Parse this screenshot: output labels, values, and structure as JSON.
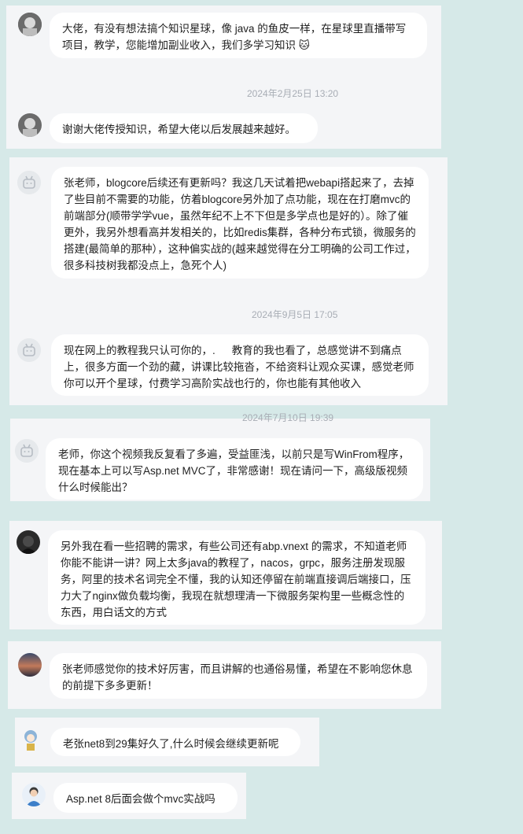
{
  "messages": [
    {
      "text": "大佬，有没有想法搞个知识星球，像 java 的鱼皮一样，在星球里直播带写项目，教学，您能增加副业收入，我们多学习知识 🐱"
    },
    {
      "time": "2024年2月25日 13:20",
      "text": "谢谢大佬传授知识，希望大佬以后发展越来越好。"
    },
    {
      "text": "张老师，blogcore后续还有更新吗？我这几天试着把webapi搭起来了，去掉了些目前不需要的功能，仿着blogcore另外加了点功能，现在在打磨mvc的前端部分(顺带学学vue，虽然年纪不上不下但是多学点也是好的）。除了催更外，我另外想看高并发相关的，比如redis集群，各种分布式锁，微服务的搭建(最简单的那种），这种偏实战的(越来越觉得在分工明确的公司工作过，很多科技树我都没点上，急死个人)"
    },
    {
      "time": "2024年9月5日 17:05",
      "text": "现在网上的教程我只认可你的，. 　 教育的我也看了，总感觉讲不到痛点上，很多方面一个劲的藏，讲课比较拖沓，不给资料让观众买课，感觉老师你可以开个星球，付费学习高阶实战也行的，你也能有其他收入"
    },
    {
      "time": "2024年7月10日 19:39",
      "text": "老师，你这个视频我反复看了多遍，受益匪浅，以前只是写WinFrom程序，现在基本上可以写Asp.net MVC了，非常感谢！现在请问一下，高级版视频什么时候能出？"
    },
    {
      "text": "另外我在看一些招聘的需求，有些公司还有abp.vnext 的需求，不知道老师你能不能讲一讲？网上太多java的教程了，nacos，grpc，服务注册发现服务，阿里的技术名词完全不懂，我的认知还停留在前端直接调后端接口，压力大了nginx做负载均衡，我现在就想理清一下微服务架构里一些概念性的东西，用白话文的方式"
    },
    {
      "text": "张老师感觉你的技术好厉害，而且讲解的也通俗易懂，希望在不影响您休息的前提下多多更新！"
    },
    {
      "text": "老张net8到29集好久了,什么时候会继续更新呢"
    },
    {
      "text": "Asp.net 8后面会做个mvc实战吗"
    }
  ],
  "icons": {
    "avatar_1": "user-avatar-icon",
    "avatar_tv": "bilibili-tv-avatar-icon",
    "avatar_dark": "dark-avatar-icon",
    "avatar_sunset": "sunset-avatar-icon",
    "avatar_anime": "anime-avatar-icon",
    "avatar_person": "person-avatar-icon"
  }
}
